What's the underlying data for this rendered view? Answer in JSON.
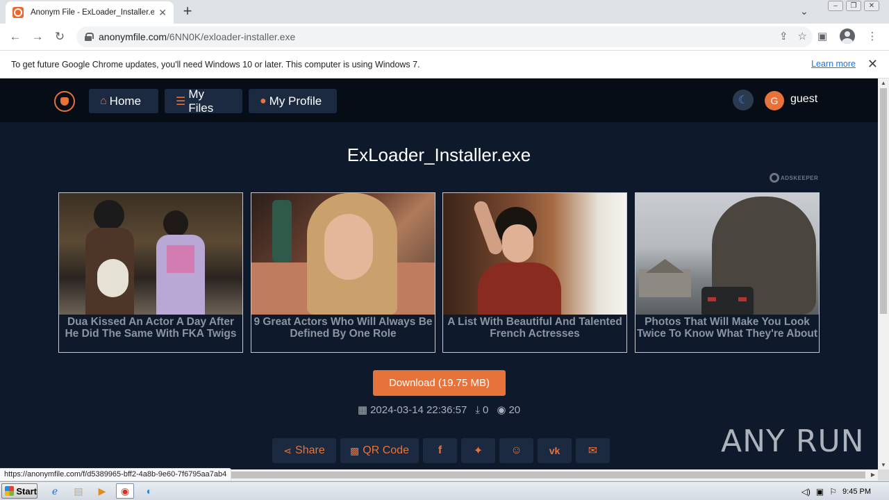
{
  "browser": {
    "tab_title": "Anonym File - ExLoader_Installer.exe",
    "tab_close": "✕",
    "new_tab": "+",
    "url_host": "anonymfile.com",
    "url_path": "/6NN0K/exloader-installer.exe"
  },
  "infobar": {
    "message": "To get future Google Chrome updates, you'll need Windows 10 or later. This computer is using Windows 7.",
    "learn_more": "Learn more"
  },
  "site": {
    "nav": {
      "home": "Home",
      "my_files": "My Files",
      "my_profile": "My Profile"
    },
    "user": {
      "avatar_letter": "G",
      "name": "guest"
    },
    "file_title": "ExLoader_Installer.exe",
    "ad_network": "ADSKEEPER",
    "ads": [
      {
        "caption": "Dua Kissed An Actor A Day After He Did The Same With FKA Twigs"
      },
      {
        "caption": "9 Great Actors Who Will Always Be Defined By One Role"
      },
      {
        "caption": "A List With Beautiful And Talented French Actresses"
      },
      {
        "caption": "Photos That Will Make You Look Twice To Know What They're About"
      }
    ],
    "download_label": "Download (19.75 MB)",
    "meta": {
      "date": "2024-03-14 22:36:57",
      "downloads": "0",
      "views": "20"
    },
    "share": {
      "share_label": "Share",
      "qr_label": "QR Code"
    }
  },
  "status_url": "https://anonymfile.com/f/d5389965-bff2-4a8b-9e60-7f6795aa7ab4",
  "watermark": "ANY RUN",
  "taskbar": {
    "start": "Start",
    "time": "9:45 PM"
  },
  "colors": {
    "accent": "#e8733a",
    "page_bg": "#0e1a2b",
    "navbar_bg": "#070d16"
  }
}
